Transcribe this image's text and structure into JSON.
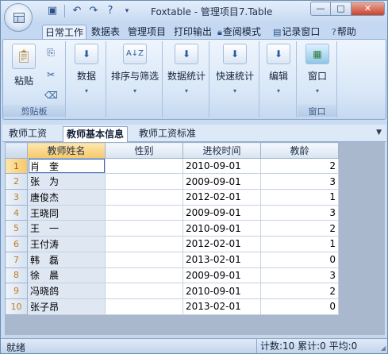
{
  "window": {
    "title": "Foxtable - 管理项目7.Table",
    "quick_access": [
      "save-icon",
      "undo-icon",
      "redo-icon",
      "help-icon"
    ],
    "controls": [
      "minimize",
      "maximize",
      "close"
    ]
  },
  "ribbon_tabs": [
    {
      "label": "日常工作",
      "active": true
    },
    {
      "label": "数据表"
    },
    {
      "label": "管理项目"
    },
    {
      "label": "打印输出"
    },
    {
      "label": "查阅模式",
      "icon": "lock-icon"
    },
    {
      "label": "记录窗口",
      "icon": "table-icon"
    },
    {
      "label": "帮助",
      "icon": "help-icon"
    }
  ],
  "ribbon": {
    "clipboard": {
      "paste": "粘贴",
      "group_label": "剪贴板"
    },
    "buttons": {
      "data": "数据",
      "sort_filter": "排序与筛选",
      "stats": "数据统计",
      "quick_stats": "快速统计",
      "edit": "编辑",
      "window": "窗口"
    },
    "window_group_label": "窗口"
  },
  "sheet_tabs": [
    {
      "label": "教师工资"
    },
    {
      "label": "教师基本信息",
      "active": true
    },
    {
      "label": "教师工资标准"
    }
  ],
  "grid": {
    "columns": [
      "教师姓名",
      "性别",
      "进校时间",
      "教龄"
    ],
    "rows": [
      {
        "no": "1",
        "name": "肖　奎",
        "gender": "",
        "date": "2010-09-01",
        "years": "2"
      },
      {
        "no": "2",
        "name": "张　为",
        "gender": "",
        "date": "2009-09-01",
        "years": "3"
      },
      {
        "no": "3",
        "name": "唐俊杰",
        "gender": "",
        "date": "2012-02-01",
        "years": "1"
      },
      {
        "no": "4",
        "name": "王晓同",
        "gender": "",
        "date": "2009-09-01",
        "years": "3"
      },
      {
        "no": "5",
        "name": "王　一",
        "gender": "",
        "date": "2010-09-01",
        "years": "2"
      },
      {
        "no": "6",
        "name": "王付涛",
        "gender": "",
        "date": "2012-02-01",
        "years": "1"
      },
      {
        "no": "7",
        "name": "韩　磊",
        "gender": "",
        "date": "2013-02-01",
        "years": "0"
      },
      {
        "no": "8",
        "name": "徐　晨",
        "gender": "",
        "date": "2009-09-01",
        "years": "3"
      },
      {
        "no": "9",
        "name": "冯晓鸽",
        "gender": "",
        "date": "2010-09-01",
        "years": "2"
      },
      {
        "no": "10",
        "name": "张子昂",
        "gender": "",
        "date": "2013-02-01",
        "years": "0"
      }
    ]
  },
  "status": {
    "left": "就绪",
    "right": "计数:10  累计:0  平均:0"
  },
  "colors": {
    "accent": "#c9dcf2",
    "selection": "#f7c86a",
    "row_number": "#c57b1a"
  }
}
